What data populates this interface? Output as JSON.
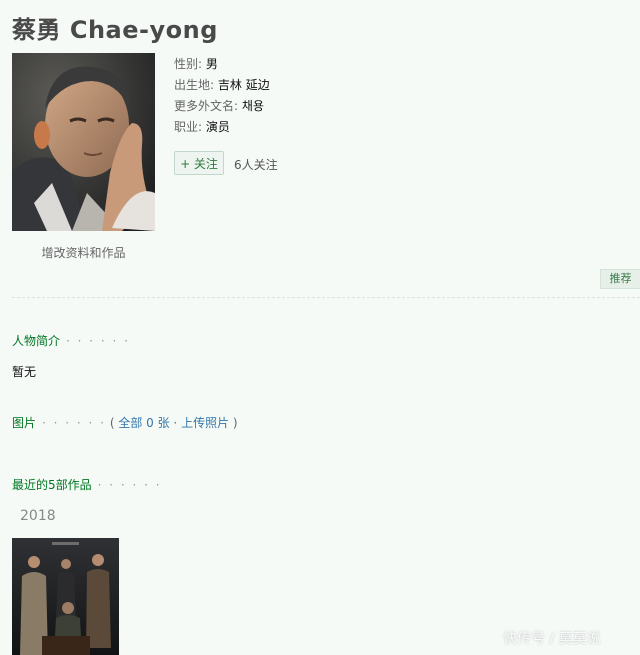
{
  "person": {
    "name": "蔡勇 Chae-yong",
    "edit_link": "增改资料和作品",
    "info": [
      {
        "key": "性别",
        "value": "男"
      },
      {
        "key": "出生地",
        "value": "吉林 延边"
      },
      {
        "key": "更多外文名",
        "value": "채용"
      },
      {
        "key": "职业",
        "value": "演员"
      }
    ],
    "follow_label": "+ 关注",
    "follow_count": "6人关注",
    "recommend_label": "推荐"
  },
  "sections": {
    "bio_title": "人物简介",
    "bio_dots": "· · · · · ·",
    "bio_text": "暂无",
    "photos_title": "图片",
    "photos_dots": "· · · · · ·",
    "photos_open": "(",
    "photos_all": "全部 0 张",
    "photos_sep": "·",
    "photos_upload": "上传照片",
    "photos_close": ")",
    "works_title": "最近的5部作品",
    "works_dots": "· · · · · ·",
    "works_year": "2018"
  },
  "watermark": "快传号 / 莫莫说",
  "colors": {
    "background": "#f5faf7",
    "section_title": "#007722",
    "link": "#3377aa",
    "follow_button_bg": "#eef5f0"
  }
}
